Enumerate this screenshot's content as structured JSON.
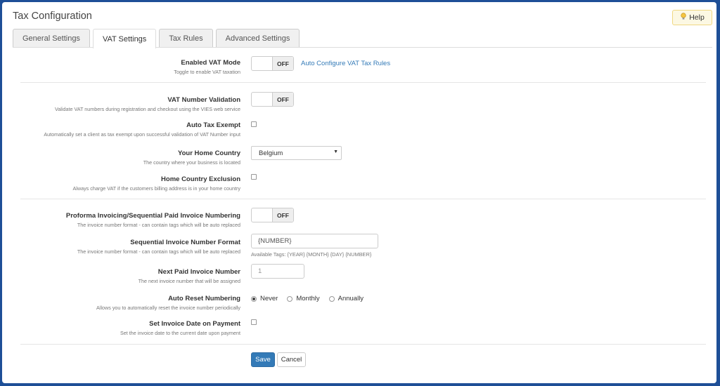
{
  "page": {
    "title": "Tax Configuration",
    "help_label": "Help"
  },
  "tabs": [
    {
      "label": "General Settings"
    },
    {
      "label": "VAT Settings"
    },
    {
      "label": "Tax Rules"
    },
    {
      "label": "Advanced Settings"
    }
  ],
  "vat": {
    "enabled": {
      "label": "Enabled VAT Mode",
      "desc": "Toggle to enable VAT taxation",
      "state": "OFF",
      "link": "Auto Configure VAT Tax Rules"
    },
    "validation": {
      "label": "VAT Number Validation",
      "desc": "Validate VAT numbers during registration and checkout using the VIES web service",
      "state": "OFF"
    },
    "auto_exempt": {
      "label": "Auto Tax Exempt",
      "desc": "Automatically set a client as tax exempt upon successful validation of VAT Number input"
    },
    "home_country": {
      "label": "Your Home Country",
      "desc": "The country where your business is located",
      "value": "Belgium"
    },
    "home_exclusion": {
      "label": "Home Country Exclusion",
      "desc": "Always charge VAT if the customers billing address is in your home country"
    },
    "proforma": {
      "label": "Proforma Invoicing/Sequential Paid Invoice Numbering",
      "desc": "The invoice number format - can contain tags which will be auto replaced",
      "state": "OFF"
    },
    "seq_format": {
      "label": "Sequential Invoice Number Format",
      "desc": "The invoice number format - can contain tags which will be auto replaced",
      "value": "{NUMBER}",
      "tags": "Available Tags: {YEAR} {MONTH} {DAY} {NUMBER}"
    },
    "next_paid": {
      "label": "Next Paid Invoice Number",
      "desc": "The next invoice number that will be assigned",
      "placeholder": "1"
    },
    "auto_reset": {
      "label": "Auto Reset Numbering",
      "desc": "Allows you to automatically reset the invoice number periodically",
      "options": [
        "Never",
        "Monthly",
        "Annually"
      ],
      "selected": "Never"
    },
    "invoice_date": {
      "label": "Set Invoice Date on Payment",
      "desc": "Set the invoice date to the current date upon payment"
    }
  },
  "actions": {
    "save": "Save",
    "cancel": "Cancel"
  },
  "colors": {
    "accent": "#337ab7",
    "frame": "#1e4f97",
    "help_bg": "#fcf8e3"
  }
}
